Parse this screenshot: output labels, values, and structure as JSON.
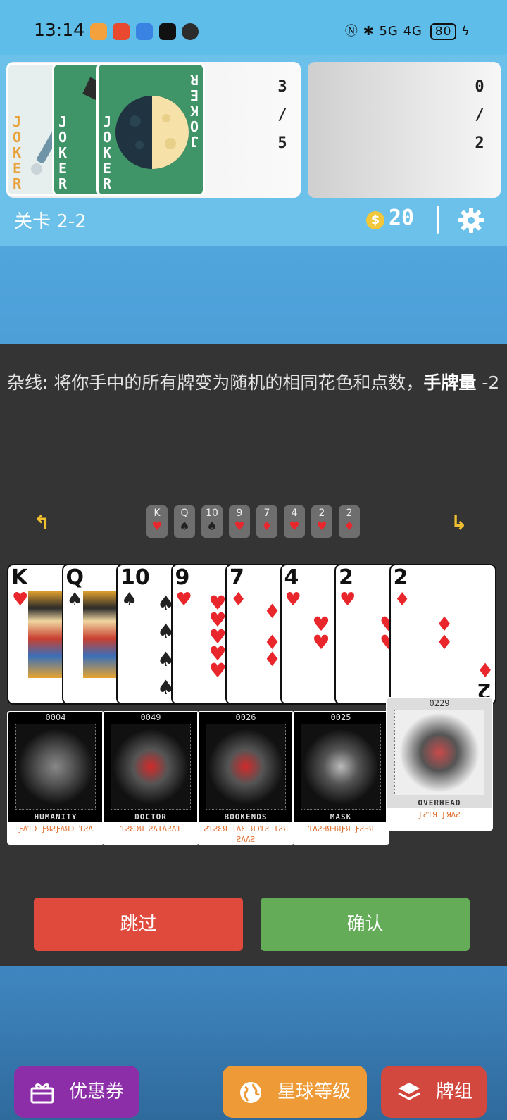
{
  "status_bar": {
    "time": "13:14",
    "network": "5G 4G",
    "battery": "80"
  },
  "top": {
    "joker_count": [
      "3",
      "/",
      "5"
    ],
    "consumable_count": [
      "0",
      "/",
      "2"
    ],
    "joker_word": [
      "J",
      "O",
      "K",
      "E",
      "R"
    ],
    "level": "关卡 2-2",
    "coin_symbol": "$",
    "coins": "20"
  },
  "dialog": {
    "description_plain": "杂线: 将你手中的所有牌变为随机的相同花色和点数，",
    "description_bold": "手牌量",
    "description_tail": " -2",
    "arrow_left": "↰",
    "arrow_right": "↳",
    "mini_cards": [
      {
        "rank": "K",
        "suit": "♥",
        "color": "#e8262c"
      },
      {
        "rank": "Q",
        "suit": "♠",
        "color": "#222222"
      },
      {
        "rank": "10",
        "suit": "♠",
        "color": "#222222"
      },
      {
        "rank": "9",
        "suit": "♥",
        "color": "#e8262c"
      },
      {
        "rank": "7",
        "suit": "♦",
        "color": "#e8262c"
      },
      {
        "rank": "4",
        "suit": "♥",
        "color": "#e8262c"
      },
      {
        "rank": "2",
        "suit": "♥",
        "color": "#e8262c"
      },
      {
        "rank": "2",
        "suit": "♦",
        "color": "#e8262c"
      }
    ],
    "hand": [
      {
        "rank": "K",
        "suit": "♥"
      },
      {
        "rank": "Q",
        "suit": "♠"
      },
      {
        "rank": "10",
        "suit": "♠"
      },
      {
        "rank": "9",
        "suit": "♥"
      },
      {
        "rank": "7",
        "suit": "♦"
      },
      {
        "rank": "4",
        "suit": "♥"
      },
      {
        "rank": "2",
        "suit": "♥"
      },
      {
        "rank": "2",
        "suit": "♦"
      }
    ],
    "tarot": [
      {
        "num": "0004",
        "name": "HUMANITY",
        "label": "ƑΛƬƆ ƑЯƧƑΛЯƆ ƬƧΛ"
      },
      {
        "num": "0049",
        "name": "DOCTOR",
        "label": "ƬƧƐƆЯ ƧΛƖΛƧΛƬ"
      },
      {
        "num": "0026",
        "name": "BOOKENDS",
        "label": "ƧƬƧƐЯ ƖΛƐ ЯƆƬƧ ƖƧЯ ƧΛΛƧ"
      },
      {
        "num": "0025",
        "name": "MASK",
        "label": "ƬΛƧƎЯƎЯƑЯ ƑƧƎЯ"
      },
      {
        "num": "0229",
        "name": "OVERHEAD",
        "label": "ƑƧƬЯ ƑЯΛƧ"
      }
    ],
    "skip_label": "跳过",
    "confirm_label": "确认"
  },
  "bottom": {
    "coupon_label": "优惠券",
    "planet_label": "星球等级",
    "deck_label": "牌组"
  },
  "colors": {
    "skip": "#e04a3d",
    "confirm": "#64ac58",
    "coupon": "#8c2ea8",
    "planet": "#ee9a36",
    "deck": "#d2483f"
  }
}
